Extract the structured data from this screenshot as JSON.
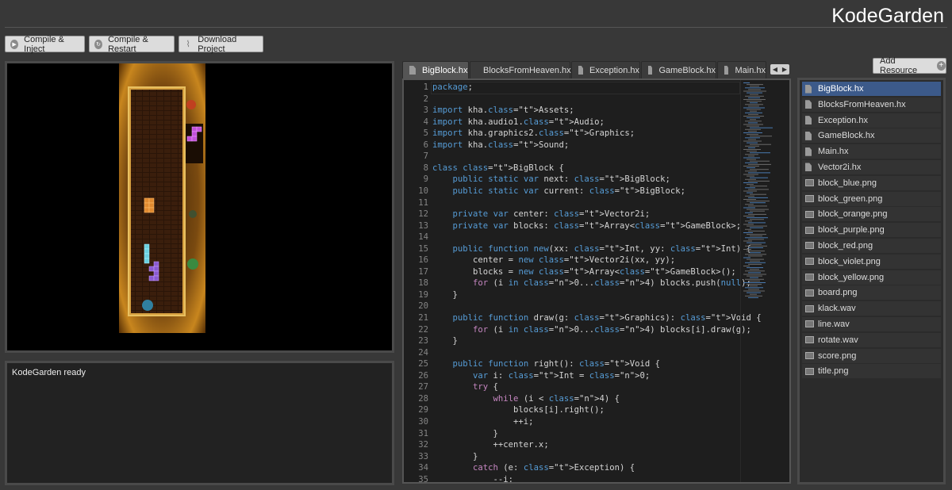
{
  "app": {
    "title": "KodeGarden"
  },
  "toolbar": {
    "compile_inject": "Compile & Inject",
    "compile_restart": "Compile & Restart",
    "download_project": "Download Project"
  },
  "console": {
    "text": "KodeGarden ready"
  },
  "tabs": [
    "BigBlock.hx",
    "BlocksFromHeaven.hx",
    "Exception.hx",
    "GameBlock.hx",
    "Main.hx"
  ],
  "active_tab": "BigBlock.hx",
  "editor": {
    "lines": [
      {
        "n": "1",
        "code": "package;"
      },
      {
        "n": "2",
        "code": ""
      },
      {
        "n": "3",
        "code": "import kha.Assets;"
      },
      {
        "n": "4",
        "code": "import kha.audio1.Audio;"
      },
      {
        "n": "5",
        "code": "import kha.graphics2.Graphics;"
      },
      {
        "n": "6",
        "code": "import kha.Sound;"
      },
      {
        "n": "7",
        "code": ""
      },
      {
        "n": "8",
        "code": "class BigBlock {"
      },
      {
        "n": "9",
        "code": "    public static var next: BigBlock;"
      },
      {
        "n": "10",
        "code": "    public static var current: BigBlock;"
      },
      {
        "n": "11",
        "code": ""
      },
      {
        "n": "12",
        "code": "    private var center: Vector2i;"
      },
      {
        "n": "13",
        "code": "    private var blocks: Array<GameBlock>;"
      },
      {
        "n": "14",
        "code": ""
      },
      {
        "n": "15",
        "code": "    public function new(xx: Int, yy: Int) {"
      },
      {
        "n": "16",
        "code": "        center = new Vector2i(xx, yy);"
      },
      {
        "n": "17",
        "code": "        blocks = new Array<GameBlock>();"
      },
      {
        "n": "18",
        "code": "        for (i in 0...4) blocks.push(null);"
      },
      {
        "n": "19",
        "code": "    }"
      },
      {
        "n": "20",
        "code": ""
      },
      {
        "n": "21",
        "code": "    public function draw(g: Graphics): Void {"
      },
      {
        "n": "22",
        "code": "        for (i in 0...4) blocks[i].draw(g);"
      },
      {
        "n": "23",
        "code": "    }"
      },
      {
        "n": "24",
        "code": ""
      },
      {
        "n": "25",
        "code": "    public function right(): Void {"
      },
      {
        "n": "26",
        "code": "        var i: Int = 0;"
      },
      {
        "n": "27",
        "code": "        try {"
      },
      {
        "n": "28",
        "code": "            while (i < 4) {"
      },
      {
        "n": "29",
        "code": "                blocks[i].right();"
      },
      {
        "n": "30",
        "code": "                ++i;"
      },
      {
        "n": "31",
        "code": "            }"
      },
      {
        "n": "32",
        "code": "            ++center.x;"
      },
      {
        "n": "33",
        "code": "        }"
      },
      {
        "n": "34",
        "code": "        catch (e: Exception) {"
      },
      {
        "n": "35",
        "code": "            --i;"
      }
    ]
  },
  "resources": {
    "add_label": "Add Resource",
    "files": [
      {
        "name": "BigBlock.hx",
        "kind": "code",
        "selected": true
      },
      {
        "name": "BlocksFromHeaven.hx",
        "kind": "code"
      },
      {
        "name": "Exception.hx",
        "kind": "code"
      },
      {
        "name": "GameBlock.hx",
        "kind": "code"
      },
      {
        "name": "Main.hx",
        "kind": "code"
      },
      {
        "name": "Vector2i.hx",
        "kind": "code"
      },
      {
        "name": "block_blue.png",
        "kind": "image"
      },
      {
        "name": "block_green.png",
        "kind": "image"
      },
      {
        "name": "block_orange.png",
        "kind": "image"
      },
      {
        "name": "block_purple.png",
        "kind": "image"
      },
      {
        "name": "block_red.png",
        "kind": "image"
      },
      {
        "name": "block_violet.png",
        "kind": "image"
      },
      {
        "name": "block_yellow.png",
        "kind": "image"
      },
      {
        "name": "board.png",
        "kind": "image"
      },
      {
        "name": "klack.wav",
        "kind": "image"
      },
      {
        "name": "line.wav",
        "kind": "image"
      },
      {
        "name": "rotate.wav",
        "kind": "image"
      },
      {
        "name": "score.png",
        "kind": "image"
      },
      {
        "name": "title.png",
        "kind": "image"
      }
    ]
  },
  "icons": {
    "play": "play-icon",
    "restart": "restart-icon",
    "download": "paperclip-icon",
    "add": "plus-icon",
    "file": "file-icon",
    "image": "image-icon"
  }
}
